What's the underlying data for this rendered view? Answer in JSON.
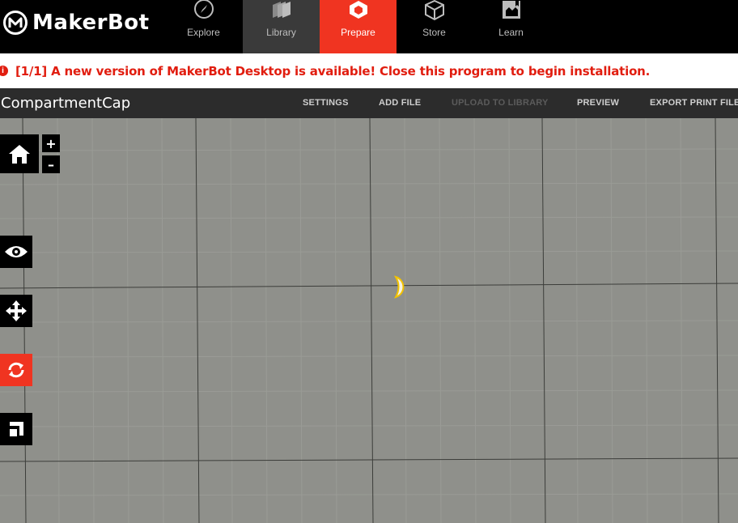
{
  "app": {
    "logo_text": "MakerBot"
  },
  "nav": {
    "items": [
      {
        "label": "Explore",
        "icon": "compass-icon"
      },
      {
        "label": "Library",
        "icon": "library-icon"
      },
      {
        "label": "Prepare",
        "icon": "prepare-icon"
      },
      {
        "label": "Store",
        "icon": "box-icon"
      },
      {
        "label": "Learn",
        "icon": "book-icon"
      }
    ],
    "active": "Prepare"
  },
  "banner": {
    "text": "[1/1] A new version of MakerBot Desktop is available! Close this program to begin installation."
  },
  "project": {
    "name": "CompartmentCap",
    "actions": {
      "settings": "SETTINGS",
      "add_file": "ADD FILE",
      "upload": "UPLOAD TO LIBRARY",
      "preview": "PREVIEW",
      "export": "EXPORT PRINT FILE"
    }
  },
  "tools": {
    "zoom_in": "+",
    "zoom_out": "–",
    "items": [
      "home-icon",
      "eye-icon",
      "move-icon",
      "rotate-icon",
      "scale-icon"
    ],
    "active": "rotate-icon"
  },
  "colors": {
    "accent": "#f03421",
    "banner_text": "#e11d0f",
    "viewport_bg": "#8f908b",
    "model_fill": "#f6f3e4",
    "model_outline": "#f2c200"
  }
}
